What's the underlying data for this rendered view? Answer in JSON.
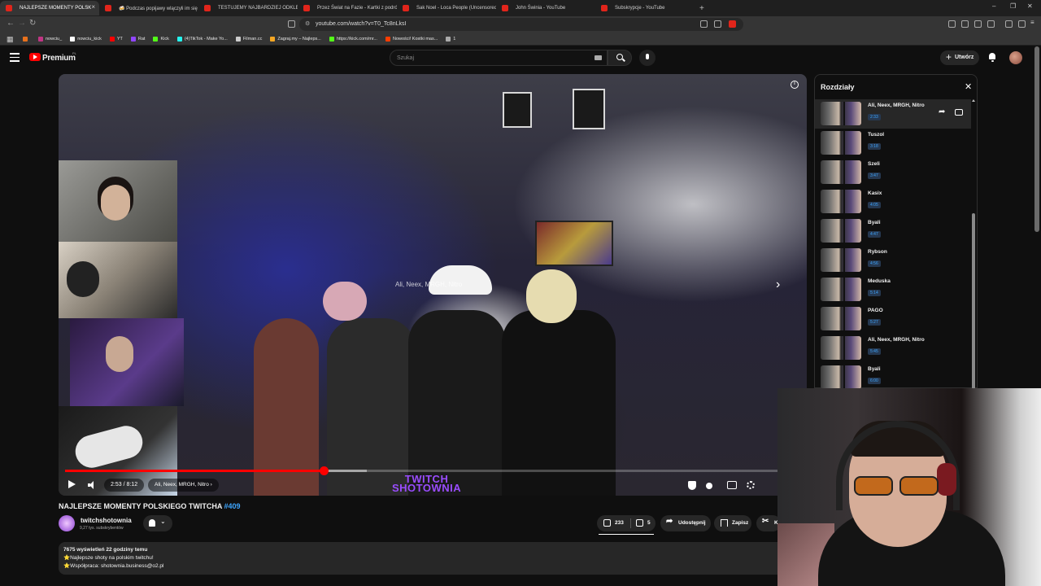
{
  "browser": {
    "tabs": [
      {
        "title": "NAJLEPSZE MOMENTY POLSK",
        "active": true
      },
      {
        "title": "🍻 Podczas popijawy wlączyli im się",
        "active": false
      },
      {
        "title": "TESTUJEMY NAJBARDZIEJ ODKLEJO",
        "active": false
      },
      {
        "title": "Przez Świat na Fazie - Kartki z podróż",
        "active": false
      },
      {
        "title": "Sak Noel - Loca People (Uncensored",
        "active": false
      },
      {
        "title": "John Świnia - YouTube",
        "active": false
      },
      {
        "title": "Subskrypcje - YouTube",
        "active": false
      }
    ],
    "new_tab": "+",
    "url": "youtube.com/watch?v=T0_Tc8nLksI",
    "bookmarks": [
      {
        "label": "",
        "color": "#e8711c"
      },
      {
        "label": "nowciu_",
        "color": "#c13584"
      },
      {
        "label": "nowciu_kick",
        "color": "#ffffff"
      },
      {
        "label": "YT",
        "color": "#ff0000"
      },
      {
        "label": "Rat",
        "color": "#9146ff"
      },
      {
        "label": "Kick",
        "color": "#53fc18"
      },
      {
        "label": "(4)TikTok - Make Yo...",
        "color": "#25f4ee"
      },
      {
        "label": "Filman.cc",
        "color": "#cccccc"
      },
      {
        "label": "Zagraj.my – Najleps...",
        "color": "#f5a623"
      },
      {
        "label": "https://kick.com/mr...",
        "color": "#53fc18"
      },
      {
        "label": "Nowości! Kostki mas...",
        "color": "#ff3d00"
      },
      {
        "label": "1",
        "color": "#aaaaaa"
      }
    ]
  },
  "masthead": {
    "brand": "Premium",
    "country": "PL",
    "search_placeholder": "Szukaj",
    "create_label": "Utwórz"
  },
  "player": {
    "scene_label": "Ali, Neex, MRGH, Nitro",
    "time": "2:53 / 8:12",
    "chapter": "Ali, Neex, MRGH, Nitro ›",
    "watermark": "TWITCH\nSHOTOWNIA",
    "progress_played": 0.352,
    "progress_loaded": 0.41
  },
  "video": {
    "title": "NAJLEPSZE MOMENTY POLSKIEGO TWITCHA ",
    "tag": "#409",
    "channel_name": "twitchshotownia",
    "subscribers": "9,27 tys. subskrybentów",
    "likes": "233",
    "dislikes": "5",
    "share_label": "Udostępnij",
    "save_label": "Zapisz",
    "clip_label": "K",
    "views_line": "7675 wyświetleń  22 godziny temu",
    "desc_line1": "⭐Najlepsze shoty na polskim twitchu!",
    "desc_line2": "⭐Współpraca: shotownia.business@o2.pl"
  },
  "chapters": {
    "title": "Rozdziały",
    "items": [
      {
        "title": "Ali, Neex, MRGH, Nitro",
        "time": "2:33",
        "active": true
      },
      {
        "title": "Tuszol",
        "time": "3:18",
        "active": false
      },
      {
        "title": "Szeli",
        "time": "3:47",
        "active": false
      },
      {
        "title": "Kasix",
        "time": "4:05",
        "active": false
      },
      {
        "title": "Byali",
        "time": "4:47",
        "active": false
      },
      {
        "title": "Rybson",
        "time": "4:56",
        "active": false
      },
      {
        "title": "Meduska",
        "time": "5:14",
        "active": false
      },
      {
        "title": "PAGO",
        "time": "5:27",
        "active": false
      },
      {
        "title": "Ali, Neex, MRGH, Nitro",
        "time": "5:45",
        "active": false
      },
      {
        "title": "Byali",
        "time": "6:00",
        "active": false
      }
    ]
  }
}
